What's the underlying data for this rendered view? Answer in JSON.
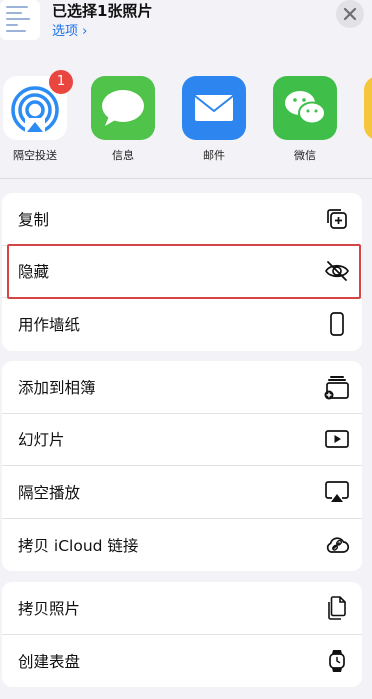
{
  "header": {
    "title": "已选择1张照片",
    "options_link": "选项 ›"
  },
  "apps": [
    {
      "label": "隔空投送",
      "icon": "airdrop-icon",
      "badge": "1"
    },
    {
      "label": "信息",
      "icon": "messages-icon"
    },
    {
      "label": "邮件",
      "icon": "mail-icon"
    },
    {
      "label": "微信",
      "icon": "wechat-icon"
    }
  ],
  "groups": [
    [
      {
        "label": "复制",
        "icon": "copy-icon"
      },
      {
        "label": "隐藏",
        "icon": "eye-slash-icon"
      },
      {
        "label": "用作墙纸",
        "icon": "phone-icon"
      }
    ],
    [
      {
        "label": "添加到相簿",
        "icon": "add-to-album-icon"
      },
      {
        "label": "幻灯片",
        "icon": "play-icon"
      },
      {
        "label": "隔空播放",
        "icon": "airplay-icon"
      },
      {
        "label": "拷贝 iCloud 链接",
        "icon": "cloud-link-icon"
      }
    ],
    [
      {
        "label": "拷贝照片",
        "icon": "copy-photo-icon"
      },
      {
        "label": "创建表盘",
        "icon": "watch-icon"
      }
    ]
  ],
  "colors": {
    "accent": "#1a73e8",
    "badge": "#e9463f",
    "highlight": "#d64545"
  }
}
